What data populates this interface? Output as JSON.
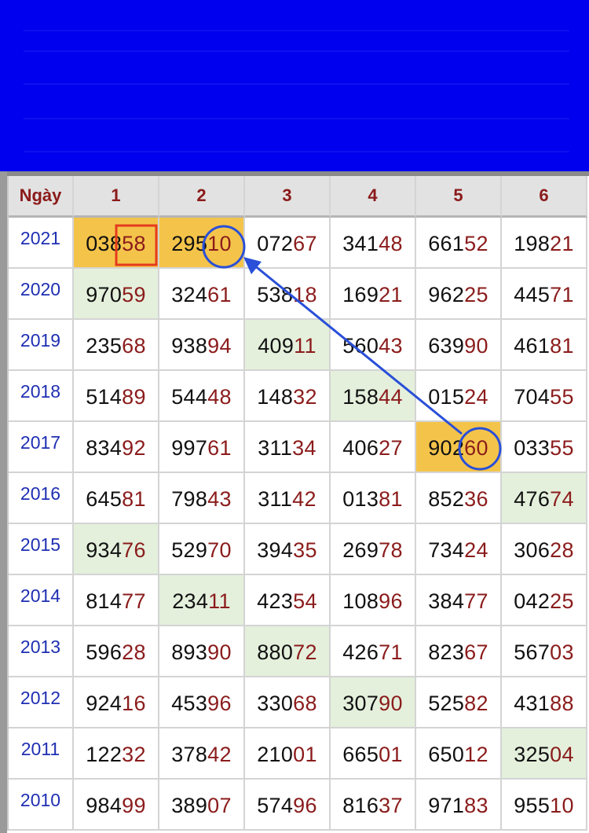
{
  "table": {
    "header": {
      "first": "Ngày",
      "columns": [
        "1",
        "2",
        "3",
        "4",
        "5",
        "6"
      ]
    },
    "rows": [
      {
        "year": "2021",
        "cells": [
          [
            "038",
            "58"
          ],
          [
            "295",
            "10"
          ],
          [
            "072",
            "67"
          ],
          [
            "341",
            "48"
          ],
          [
            "661",
            "52"
          ],
          [
            "198",
            "21"
          ]
        ],
        "highlights": [
          "orange",
          "orange",
          "",
          "",
          "",
          ""
        ]
      },
      {
        "year": "2020",
        "cells": [
          [
            "970",
            "59"
          ],
          [
            "324",
            "61"
          ],
          [
            "538",
            "18"
          ],
          [
            "169",
            "21"
          ],
          [
            "962",
            "25"
          ],
          [
            "445",
            "71"
          ]
        ],
        "highlights": [
          "green",
          "",
          "",
          "",
          "",
          ""
        ]
      },
      {
        "year": "2019",
        "cells": [
          [
            "235",
            "68"
          ],
          [
            "938",
            "94"
          ],
          [
            "409",
            "11"
          ],
          [
            "560",
            "43"
          ],
          [
            "639",
            "90"
          ],
          [
            "461",
            "81"
          ]
        ],
        "highlights": [
          "",
          "",
          "green",
          "",
          "",
          ""
        ]
      },
      {
        "year": "2018",
        "cells": [
          [
            "514",
            "89"
          ],
          [
            "544",
            "48"
          ],
          [
            "148",
            "32"
          ],
          [
            "158",
            "44"
          ],
          [
            "015",
            "24"
          ],
          [
            "704",
            "55"
          ]
        ],
        "highlights": [
          "",
          "",
          "",
          "green",
          "",
          ""
        ]
      },
      {
        "year": "2017",
        "cells": [
          [
            "834",
            "92"
          ],
          [
            "997",
            "61"
          ],
          [
            "311",
            "34"
          ],
          [
            "406",
            "27"
          ],
          [
            "902",
            "60"
          ],
          [
            "033",
            "55"
          ]
        ],
        "highlights": [
          "",
          "",
          "",
          "",
          "orange",
          ""
        ]
      },
      {
        "year": "2016",
        "cells": [
          [
            "645",
            "81"
          ],
          [
            "798",
            "43"
          ],
          [
            "311",
            "42"
          ],
          [
            "013",
            "81"
          ],
          [
            "852",
            "36"
          ],
          [
            "476",
            "74"
          ]
        ],
        "highlights": [
          "",
          "",
          "",
          "",
          "",
          "green"
        ]
      },
      {
        "year": "2015",
        "cells": [
          [
            "934",
            "76"
          ],
          [
            "529",
            "70"
          ],
          [
            "394",
            "35"
          ],
          [
            "269",
            "78"
          ],
          [
            "734",
            "24"
          ],
          [
            "306",
            "28"
          ]
        ],
        "highlights": [
          "green",
          "",
          "",
          "",
          "",
          ""
        ]
      },
      {
        "year": "2014",
        "cells": [
          [
            "814",
            "77"
          ],
          [
            "234",
            "11"
          ],
          [
            "423",
            "54"
          ],
          [
            "108",
            "96"
          ],
          [
            "384",
            "77"
          ],
          [
            "042",
            "25"
          ]
        ],
        "highlights": [
          "",
          "green",
          "",
          "",
          "",
          ""
        ]
      },
      {
        "year": "2013",
        "cells": [
          [
            "596",
            "28"
          ],
          [
            "893",
            "90"
          ],
          [
            "880",
            "72"
          ],
          [
            "426",
            "71"
          ],
          [
            "823",
            "67"
          ],
          [
            "567",
            "03"
          ]
        ],
        "highlights": [
          "",
          "",
          "green",
          "",
          "",
          ""
        ]
      },
      {
        "year": "2012",
        "cells": [
          [
            "924",
            "16"
          ],
          [
            "453",
            "96"
          ],
          [
            "330",
            "68"
          ],
          [
            "307",
            "90"
          ],
          [
            "525",
            "82"
          ],
          [
            "431",
            "88"
          ]
        ],
        "highlights": [
          "",
          "",
          "",
          "green",
          "",
          ""
        ]
      },
      {
        "year": "2011",
        "cells": [
          [
            "122",
            "32"
          ],
          [
            "378",
            "42"
          ],
          [
            "210",
            "01"
          ],
          [
            "665",
            "01"
          ],
          [
            "650",
            "12"
          ],
          [
            "325",
            "04"
          ]
        ],
        "highlights": [
          "",
          "",
          "",
          "",
          "",
          "green"
        ]
      },
      {
        "year": "2010",
        "cells": [
          [
            "984",
            "99"
          ],
          [
            "389",
            "07"
          ],
          [
            "574",
            "96"
          ],
          [
            "816",
            "37"
          ],
          [
            "971",
            "83"
          ],
          [
            "955",
            "10"
          ]
        ],
        "highlights": [
          "",
          "",
          "",
          "",
          "",
          ""
        ]
      }
    ]
  },
  "colors": {
    "banner": "#0000ee",
    "highlight_orange": "#f4c44a",
    "highlight_green": "#e4f0dc",
    "header_text": "#8b1a1a",
    "year_text": "#1f2fb2",
    "tail_digits": "#8b1c1c",
    "annotation_blue": "#2a4fd8",
    "annotation_red": "#e53b1e"
  }
}
